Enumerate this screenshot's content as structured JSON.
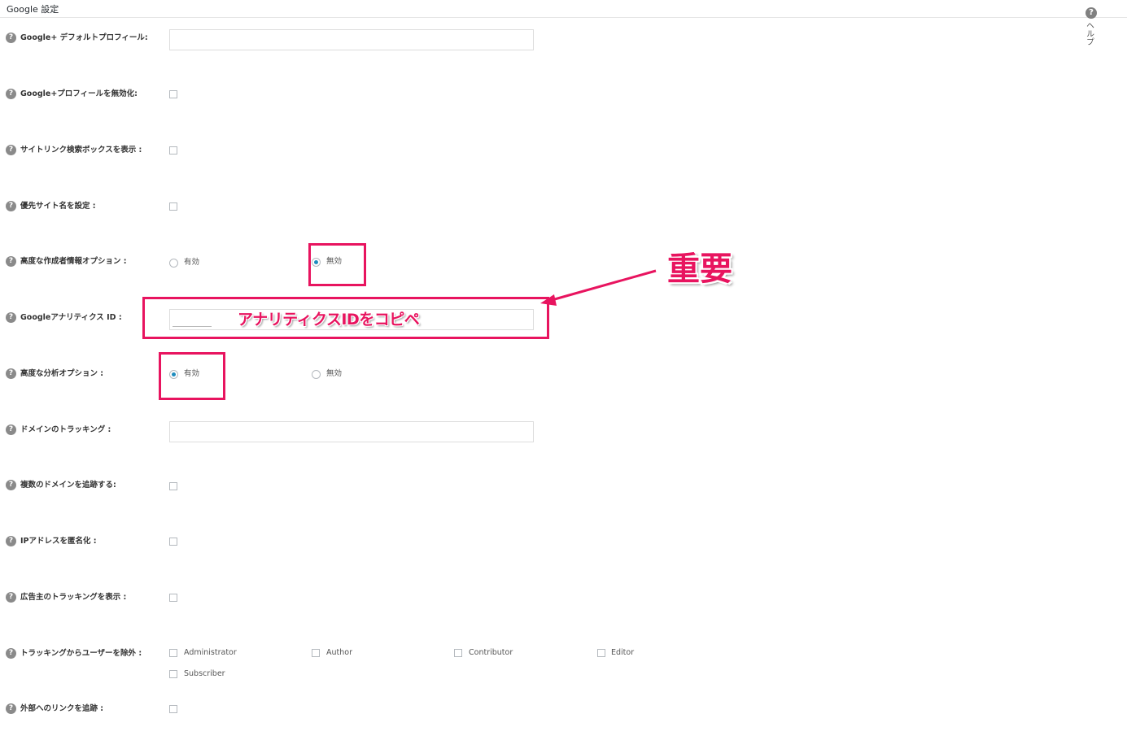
{
  "panel": {
    "title": "Google 設定",
    "help_icon": "?",
    "help_vertical": "ヘルプ"
  },
  "q_icon": "?",
  "fields": {
    "default_profile": {
      "label": "Google+ デフォルトプロフィール:",
      "value": ""
    },
    "disable_profile": {
      "label": "Google+プロフィールを無効化:",
      "checked": false
    },
    "sitelinks_search": {
      "label": "サイトリンク検索ボックスを表示 :",
      "checked": false
    },
    "preferred_site_name": {
      "label": "優先サイト名を設定 :",
      "checked": false
    },
    "advanced_author": {
      "label": "高度な作成者情報オプション :",
      "options": [
        {
          "label": "有効",
          "checked": false
        },
        {
          "label": "無効",
          "checked": true
        }
      ]
    },
    "analytics_id": {
      "label": "Googleアナリティクス ID :",
      "value": ""
    },
    "advanced_analytics": {
      "label": "高度な分析オプション :",
      "options": [
        {
          "label": "有効",
          "checked": true
        },
        {
          "label": "無効",
          "checked": false
        }
      ]
    },
    "domain_tracking": {
      "label": "ドメインのトラッキング :",
      "value": ""
    },
    "multiple_domains": {
      "label": "複数のドメインを追跡する:",
      "checked": false
    },
    "anonymize_ip": {
      "label": "IPアドレスを匿名化 :",
      "checked": false
    },
    "advertiser_tracking": {
      "label": "広告主のトラッキングを表示 :",
      "checked": false
    },
    "exclude_users": {
      "label": "トラッキングからユーザーを除外 :",
      "options": [
        "Administrator",
        "Author",
        "Contributor",
        "Editor",
        "Subscriber"
      ]
    },
    "outbound_links": {
      "label": "外部へのリンクを追跡 :",
      "checked": false
    }
  },
  "annotations": {
    "important": "重要",
    "copy_paste": "アナリティクスIDをコピペ",
    "color": "#e8145f"
  }
}
